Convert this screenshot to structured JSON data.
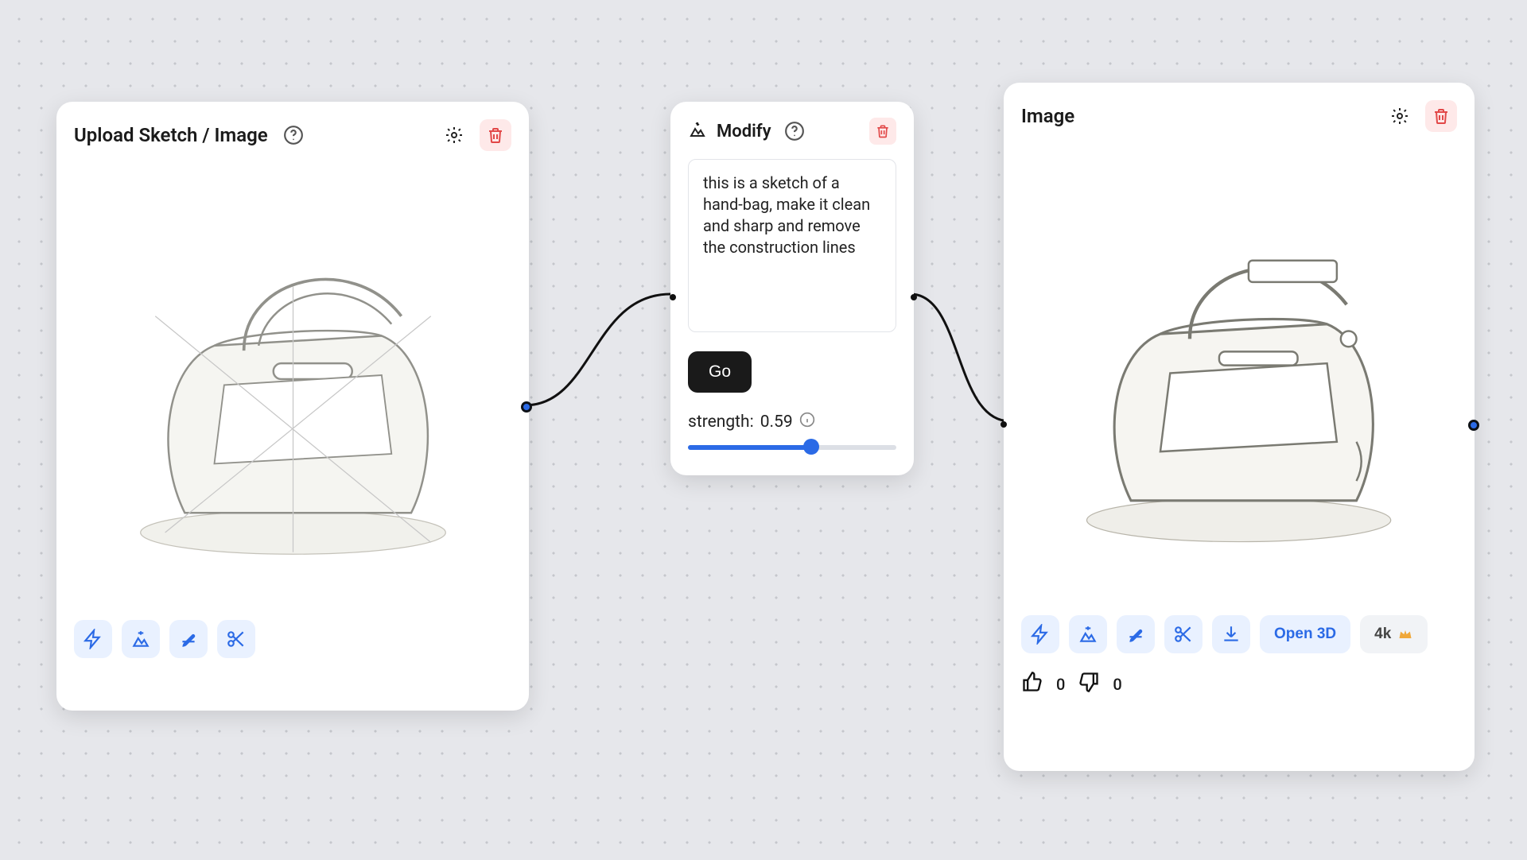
{
  "upload_card": {
    "title": "Upload Sketch / Image"
  },
  "modify_card": {
    "title": "Modify",
    "prompt": "this is a sketch of a hand-bag, make it clean and sharp and remove the construction lines",
    "go_label": "Go",
    "strength_label": "strength:",
    "strength_value": "0.59",
    "strength_numeric": 0.59
  },
  "image_card": {
    "title": "Image",
    "open3d_label": "Open 3D",
    "fourk_label": "4k",
    "likes": "0",
    "dislikes": "0"
  }
}
